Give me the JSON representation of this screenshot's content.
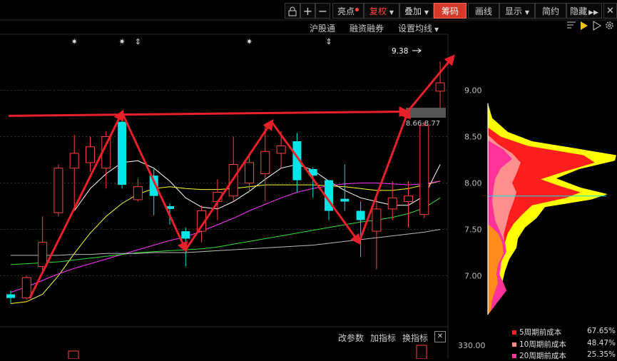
{
  "toolbar": {
    "buttons": [
      {
        "label": "亮点",
        "dot": true
      },
      {
        "label": "复权",
        "dropdown": true,
        "accent": true
      },
      {
        "label": "叠加",
        "dropdown": true
      },
      {
        "label": "筹码",
        "active": true
      },
      {
        "label": "画线"
      },
      {
        "label": "显示",
        "dropdown": true
      },
      {
        "label": "简约"
      },
      {
        "label": "隐藏"
      }
    ],
    "icons": [
      "lock-icon",
      "plus-icon",
      "minus-icon",
      "fast-forward-icon",
      "close-icon"
    ]
  },
  "subbar": {
    "items": [
      {
        "label": "沪股通"
      },
      {
        "label": "融资融券"
      },
      {
        "label": "设置均线",
        "dropdown": true
      }
    ]
  },
  "chart_data": {
    "type": "candlestick",
    "ylim": [
      6.55,
      9.55
    ],
    "y_ticks": [
      "9.00",
      "8.50",
      "8.00",
      "7.50",
      "7.00"
    ],
    "y_tick_values": [
      9.0,
      8.5,
      8.0,
      7.5,
      7.0
    ],
    "price_annotation": "9.38",
    "cost_range_label": "8.66-8.77",
    "candles": [
      {
        "o": 6.8,
        "c": 6.76,
        "h": 6.84,
        "l": 6.7
      },
      {
        "o": 6.76,
        "c": 6.98,
        "h": 7.0,
        "l": 6.74
      },
      {
        "o": 7.1,
        "c": 7.36,
        "h": 7.64,
        "l": 7.06
      },
      {
        "o": 7.68,
        "c": 8.16,
        "h": 8.2,
        "l": 7.64
      },
      {
        "o": 8.16,
        "c": 8.32,
        "h": 8.52,
        "l": 7.7
      },
      {
        "o": 8.22,
        "c": 8.39,
        "h": 8.5,
        "l": 8.12
      },
      {
        "o": 8.16,
        "c": 8.5,
        "h": 8.56,
        "l": 7.94
      },
      {
        "o": 8.66,
        "c": 7.98,
        "h": 8.78,
        "l": 7.94
      },
      {
        "o": 7.82,
        "c": 7.96,
        "h": 8.05,
        "l": 7.8
      },
      {
        "o": 8.08,
        "c": 7.86,
        "h": 8.15,
        "l": 7.65
      },
      {
        "o": 7.75,
        "c": 7.72,
        "h": 7.78,
        "l": 7.55
      },
      {
        "o": 7.48,
        "c": 7.4,
        "h": 7.52,
        "l": 7.1
      },
      {
        "o": 7.48,
        "c": 7.7,
        "h": 7.76,
        "l": 7.36
      },
      {
        "o": 7.8,
        "c": 7.9,
        "h": 8.04,
        "l": 7.6
      },
      {
        "o": 7.86,
        "c": 8.2,
        "h": 8.5,
        "l": 7.8
      },
      {
        "o": 8.0,
        "c": 8.22,
        "h": 8.3,
        "l": 7.9
      },
      {
        "o": 8.1,
        "c": 8.34,
        "h": 8.62,
        "l": 7.8
      },
      {
        "o": 8.32,
        "c": 8.4,
        "h": 8.56,
        "l": 8.16
      },
      {
        "o": 8.45,
        "c": 8.03,
        "h": 8.54,
        "l": 7.9
      },
      {
        "o": 8.15,
        "c": 8.08,
        "h": 8.17,
        "l": 7.84
      },
      {
        "o": 8.03,
        "c": 7.7,
        "h": 8.03,
        "l": 7.6
      },
      {
        "o": 7.83,
        "c": 7.8,
        "h": 8.2,
        "l": 7.7
      },
      {
        "o": 7.7,
        "c": 7.6,
        "h": 7.8,
        "l": 7.2
      },
      {
        "o": 7.48,
        "c": 7.72,
        "h": 7.88,
        "l": 7.07
      },
      {
        "o": 7.72,
        "c": 7.84,
        "h": 8.02,
        "l": 7.6
      },
      {
        "o": 7.8,
        "c": 7.86,
        "h": 8.02,
        "l": 7.52
      },
      {
        "o": 7.66,
        "c": 8.62,
        "h": 8.66,
        "l": 7.62
      },
      {
        "o": 8.99,
        "c": 9.08,
        "h": 9.31,
        "l": 8.78
      }
    ],
    "ma": [
      {
        "color": "#ffffff",
        "values": [
          null,
          null,
          null,
          null,
          7.7,
          7.94,
          8.1,
          8.22,
          8.24,
          8.16,
          8.02,
          7.84,
          7.74,
          7.72,
          7.8,
          7.91,
          8.04,
          8.16,
          8.2,
          8.14,
          8.02,
          7.92,
          7.84,
          7.8,
          7.76,
          7.76,
          7.86,
          8.2
        ]
      },
      {
        "color": "#ffff33",
        "values": [
          6.7,
          6.72,
          6.8,
          7.0,
          7.24,
          7.46,
          7.64,
          7.78,
          7.88,
          7.94,
          7.96,
          7.94,
          7.93,
          7.93,
          7.94,
          7.96,
          7.98,
          7.98,
          7.98,
          7.98,
          7.97,
          7.96,
          7.94,
          7.92,
          7.92,
          7.94,
          7.98,
          8.02
        ]
      },
      {
        "color": "#ff33ff",
        "values": [
          6.82,
          6.88,
          6.95,
          7.02,
          7.08,
          7.13,
          7.18,
          7.23,
          7.28,
          7.33,
          7.38,
          7.42,
          7.48,
          7.55,
          7.62,
          7.7,
          7.77,
          7.84,
          7.9,
          7.94,
          7.97,
          7.99,
          8.0,
          8.0,
          7.99,
          7.98,
          7.99,
          8.02
        ]
      },
      {
        "color": "#33dd33",
        "values": [
          7.12,
          7.13,
          7.14,
          7.15,
          7.17,
          7.19,
          7.21,
          7.23,
          7.25,
          7.26,
          7.27,
          7.28,
          7.29,
          7.31,
          7.34,
          7.37,
          7.4,
          7.43,
          7.46,
          7.49,
          7.52,
          7.55,
          7.58,
          7.6,
          7.63,
          7.67,
          7.73,
          7.84
        ]
      },
      {
        "color": "#bbbbbb",
        "values": [
          7.22,
          7.22,
          7.22,
          7.22,
          7.23,
          7.23,
          7.24,
          7.24,
          7.24,
          7.25,
          7.25,
          7.25,
          7.26,
          7.27,
          7.28,
          7.29,
          7.3,
          7.31,
          7.32,
          7.33,
          7.35,
          7.37,
          7.39,
          7.41,
          7.43,
          7.45,
          7.47,
          7.5
        ]
      }
    ],
    "resistance_line": [
      8.77,
      8.77
    ],
    "zigzag": [
      6.76,
      8.76,
      7.28,
      8.66,
      7.36,
      8.78,
      9.36
    ],
    "zigzag_index": [
      1.2,
      7.0,
      11.0,
      16.4,
      21.9,
      25.0,
      27.8
    ],
    "markers": [
      {
        "index": 4,
        "symbol": "✷"
      },
      {
        "index": 7,
        "symbol": "✷"
      },
      {
        "index": 8,
        "symbol": "⇕"
      },
      {
        "index": 15,
        "symbol": "✷"
      },
      {
        "index": 20,
        "symbol": "⇕"
      }
    ],
    "volume_tick": "330.00",
    "cost_distribution": [
      {
        "name": "5周期前成本",
        "percent": "67.65%",
        "color": "#ff2020"
      },
      {
        "name": "10周期前成本",
        "percent": "48.47%",
        "color": "#ff8888"
      },
      {
        "name": "20周期前成本",
        "percent": "25.35%",
        "color": "#ff3399"
      }
    ]
  },
  "indicator_bar": {
    "items": [
      {
        "label": "改参数"
      },
      {
        "label": "加指标"
      },
      {
        "label": "换指标"
      }
    ]
  }
}
